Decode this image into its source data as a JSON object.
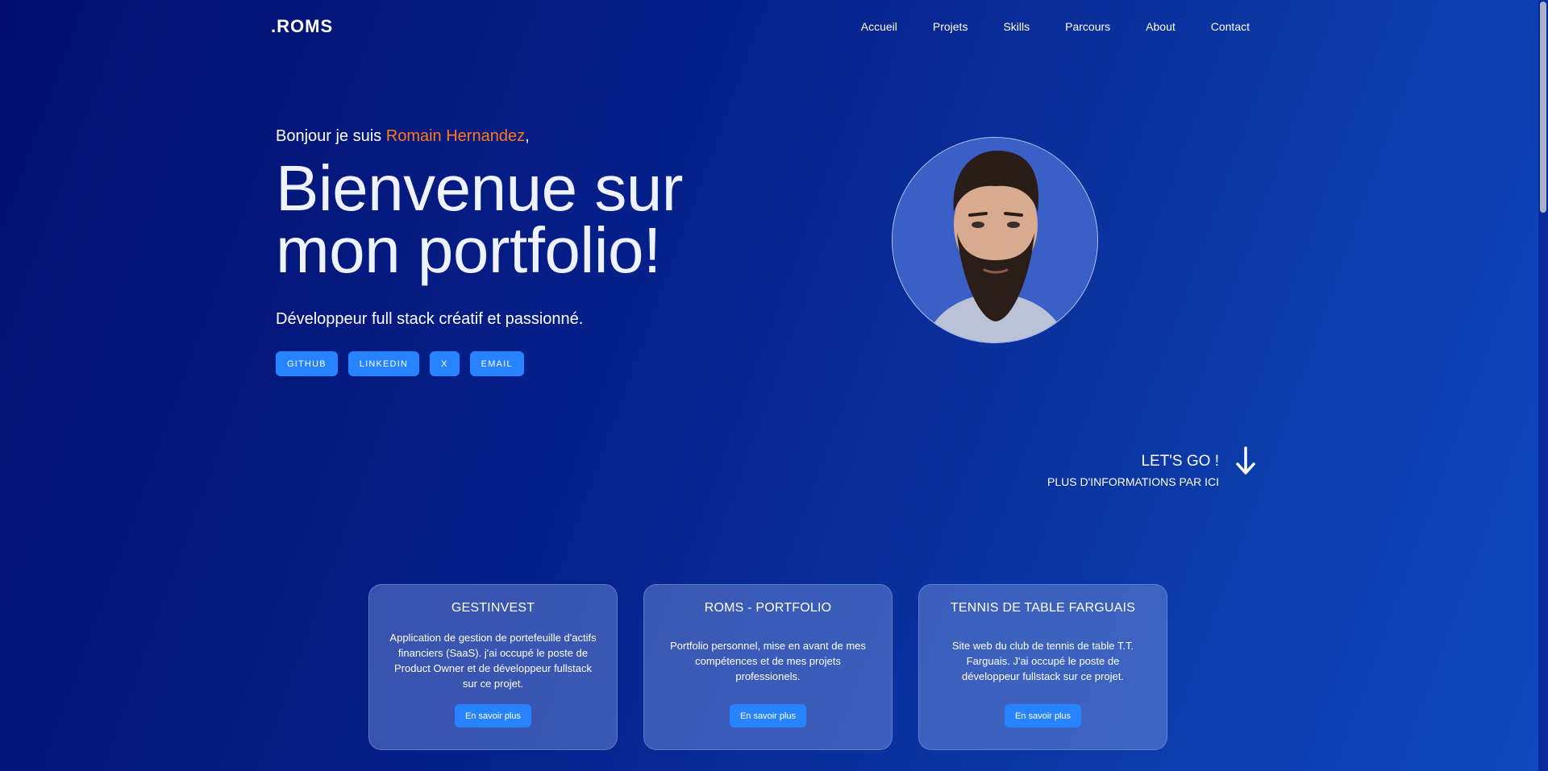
{
  "header": {
    "logo": ".ROMS",
    "nav": [
      "Accueil",
      "Projets",
      "Skills",
      "Parcours",
      "About",
      "Contact"
    ]
  },
  "hero": {
    "greeting_prefix": "Bonjour je suis ",
    "name": "Romain Hernandez",
    "greeting_suffix": ",",
    "title_line1": "Bienvenue sur",
    "title_line2": "mon portfolio!",
    "tagline": "Développeur full stack créatif et passionné.",
    "socials": [
      "GITHUB",
      "LINKEDIN",
      "X",
      "EMAIL"
    ]
  },
  "scroll_hint": {
    "line1": "LET'S GO !",
    "line2": "PLUS D'INFORMATIONS PAR ICI",
    "icon": "arrow-down-icon"
  },
  "projects": [
    {
      "title": "GESTINVEST",
      "description": "Application de gestion de portefeuille d'actifs financiers (SaaS). j'ai occupé le poste de Product Owner et de développeur fullstack sur ce projet.",
      "button": "En savoir plus"
    },
    {
      "title": "ROMS - PORTFOLIO",
      "description": "Portfolio personnel, mise en avant de mes compétences et de mes projets professionels.",
      "button": "En savoir plus"
    },
    {
      "title": "TENNIS DE TABLE FARGUAIS",
      "description": "Site web du club de tennis de table T.T. Farguais. J'ai occupé le poste de développeur fullstack sur ce projet.",
      "button": "En savoir plus"
    }
  ],
  "colors": {
    "accent": "#ff7a1a",
    "button": "#2783ff",
    "background_start": "#020f6e",
    "background_end": "#1148c0"
  }
}
